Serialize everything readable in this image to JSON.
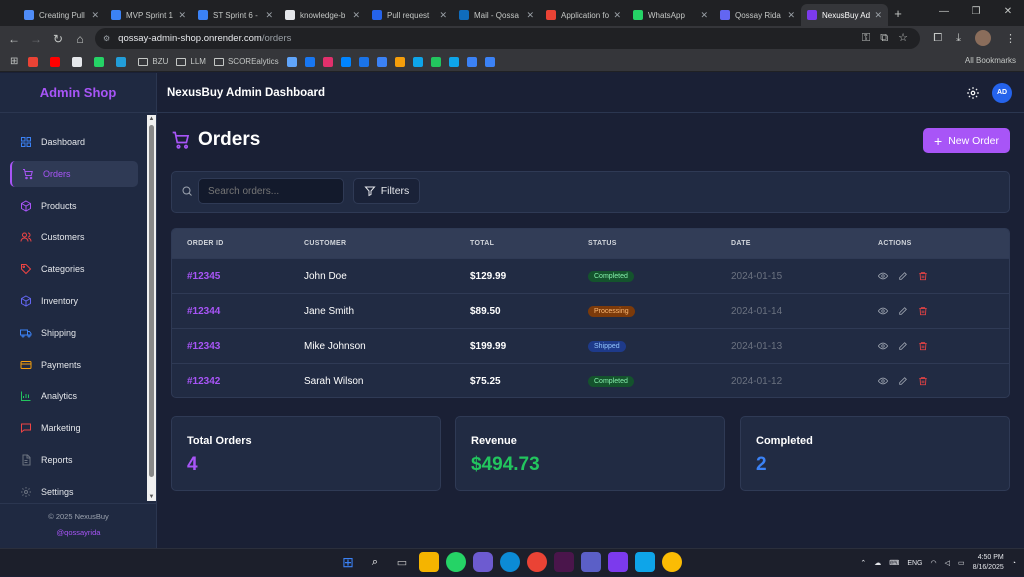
{
  "browser": {
    "tabs": [
      {
        "label": "Creating Pull",
        "color": "#4f8cf7"
      },
      {
        "label": "MVP Sprint 1",
        "color": "#3b82f6"
      },
      {
        "label": "ST Sprint 6 -",
        "color": "#3b82f6"
      },
      {
        "label": "knowledge-b",
        "color": "#e5e7eb"
      },
      {
        "label": "Pull request",
        "color": "#2563eb"
      },
      {
        "label": "Mail - Qossa",
        "color": "#0f6cbd"
      },
      {
        "label": "Application fo",
        "color": "#ea4335"
      },
      {
        "label": "WhatsApp",
        "color": "#25d366"
      },
      {
        "label": "Qossay Rida",
        "color": "#6366f1"
      },
      {
        "label": "NexusBuy Ad",
        "color": "#7c3aed"
      }
    ],
    "url_host": "qossay-admin-shop.onrender.com",
    "url_path": "/orders",
    "bookmarks": [
      {
        "label": "",
        "color": "#ea4335"
      },
      {
        "label": "",
        "color": "#ff0000"
      },
      {
        "label": "",
        "color": "#e5e7eb"
      },
      {
        "label": "",
        "color": "#25d366"
      },
      {
        "label": "",
        "color": "#229ed9"
      },
      {
        "label": "BZU",
        "color": "#9aa0a6"
      },
      {
        "label": "LLM",
        "color": "#9aa0a6"
      },
      {
        "label": "SCOREalytics",
        "color": "#9aa0a6"
      }
    ],
    "all_bookmarks": "All Bookmarks"
  },
  "sidebar": {
    "brand": "Admin Shop",
    "items": [
      {
        "label": "Dashboard",
        "icon": "grid-icon"
      },
      {
        "label": "Orders",
        "icon": "cart-icon"
      },
      {
        "label": "Products",
        "icon": "box-icon"
      },
      {
        "label": "Customers",
        "icon": "users-icon"
      },
      {
        "label": "Categories",
        "icon": "tag-icon"
      },
      {
        "label": "Inventory",
        "icon": "package-icon"
      },
      {
        "label": "Shipping",
        "icon": "truck-icon"
      },
      {
        "label": "Payments",
        "icon": "card-icon"
      },
      {
        "label": "Analytics",
        "icon": "chart-icon"
      },
      {
        "label": "Marketing",
        "icon": "message-icon"
      },
      {
        "label": "Reports",
        "icon": "file-icon"
      },
      {
        "label": "Settings",
        "icon": "gear-icon"
      }
    ],
    "footer_copyright": "© 2025 NexusBuy",
    "footer_handle": "@qossayrida"
  },
  "header": {
    "title": "NexusBuy Admin Dashboard",
    "avatar_initials": "AD"
  },
  "page": {
    "title": "Orders",
    "new_order_label": "New Order",
    "search_placeholder": "Search orders...",
    "filters_label": "Filters"
  },
  "table": {
    "columns": [
      "ORDER ID",
      "CUSTOMER",
      "TOTAL",
      "STATUS",
      "DATE",
      "ACTIONS"
    ],
    "rows": [
      {
        "id": "#12345",
        "customer": "John Doe",
        "total": "$129.99",
        "status": "Completed",
        "date": "2024-01-15"
      },
      {
        "id": "#12344",
        "customer": "Jane Smith",
        "total": "$89.50",
        "status": "Processing",
        "date": "2024-01-14"
      },
      {
        "id": "#12343",
        "customer": "Mike Johnson",
        "total": "$199.99",
        "status": "Shipped",
        "date": "2024-01-13"
      },
      {
        "id": "#12342",
        "customer": "Sarah Wilson",
        "total": "$75.25",
        "status": "Completed",
        "date": "2024-01-12"
      }
    ],
    "status_colors": {
      "Completed": {
        "bg": "#14532d",
        "fg": "#86efac"
      },
      "Processing": {
        "bg": "#7c3a0a",
        "fg": "#fdba74"
      },
      "Shipped": {
        "bg": "#1e3a8a",
        "fg": "#93c5fd"
      }
    }
  },
  "stats": [
    {
      "label": "Total Orders",
      "value": "4",
      "color": "#a855f7"
    },
    {
      "label": "Revenue",
      "value": "$494.73",
      "color": "#22c55e"
    },
    {
      "label": "Completed",
      "value": "2",
      "color": "#3b82f6"
    }
  ],
  "taskbar": {
    "lang": "ENG",
    "time": "4:50 PM",
    "date": "8/16/2025"
  }
}
